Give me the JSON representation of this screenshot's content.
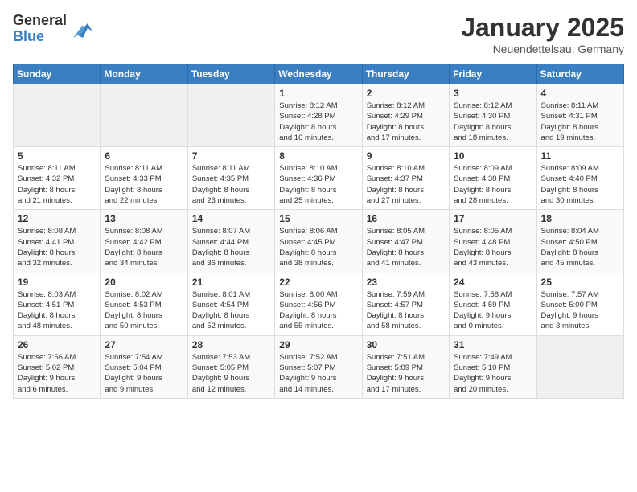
{
  "header": {
    "logo_general": "General",
    "logo_blue": "Blue",
    "month_title": "January 2025",
    "location": "Neuendettelsau, Germany"
  },
  "calendar": {
    "days_of_week": [
      "Sunday",
      "Monday",
      "Tuesday",
      "Wednesday",
      "Thursday",
      "Friday",
      "Saturday"
    ],
    "weeks": [
      [
        {
          "day": "",
          "info": ""
        },
        {
          "day": "",
          "info": ""
        },
        {
          "day": "",
          "info": ""
        },
        {
          "day": "1",
          "info": "Sunrise: 8:12 AM\nSunset: 4:28 PM\nDaylight: 8 hours\nand 16 minutes."
        },
        {
          "day": "2",
          "info": "Sunrise: 8:12 AM\nSunset: 4:29 PM\nDaylight: 8 hours\nand 17 minutes."
        },
        {
          "day": "3",
          "info": "Sunrise: 8:12 AM\nSunset: 4:30 PM\nDaylight: 8 hours\nand 18 minutes."
        },
        {
          "day": "4",
          "info": "Sunrise: 8:11 AM\nSunset: 4:31 PM\nDaylight: 8 hours\nand 19 minutes."
        }
      ],
      [
        {
          "day": "5",
          "info": "Sunrise: 8:11 AM\nSunset: 4:32 PM\nDaylight: 8 hours\nand 21 minutes."
        },
        {
          "day": "6",
          "info": "Sunrise: 8:11 AM\nSunset: 4:33 PM\nDaylight: 8 hours\nand 22 minutes."
        },
        {
          "day": "7",
          "info": "Sunrise: 8:11 AM\nSunset: 4:35 PM\nDaylight: 8 hours\nand 23 minutes."
        },
        {
          "day": "8",
          "info": "Sunrise: 8:10 AM\nSunset: 4:36 PM\nDaylight: 8 hours\nand 25 minutes."
        },
        {
          "day": "9",
          "info": "Sunrise: 8:10 AM\nSunset: 4:37 PM\nDaylight: 8 hours\nand 27 minutes."
        },
        {
          "day": "10",
          "info": "Sunrise: 8:09 AM\nSunset: 4:38 PM\nDaylight: 8 hours\nand 28 minutes."
        },
        {
          "day": "11",
          "info": "Sunrise: 8:09 AM\nSunset: 4:40 PM\nDaylight: 8 hours\nand 30 minutes."
        }
      ],
      [
        {
          "day": "12",
          "info": "Sunrise: 8:08 AM\nSunset: 4:41 PM\nDaylight: 8 hours\nand 32 minutes."
        },
        {
          "day": "13",
          "info": "Sunrise: 8:08 AM\nSunset: 4:42 PM\nDaylight: 8 hours\nand 34 minutes."
        },
        {
          "day": "14",
          "info": "Sunrise: 8:07 AM\nSunset: 4:44 PM\nDaylight: 8 hours\nand 36 minutes."
        },
        {
          "day": "15",
          "info": "Sunrise: 8:06 AM\nSunset: 4:45 PM\nDaylight: 8 hours\nand 38 minutes."
        },
        {
          "day": "16",
          "info": "Sunrise: 8:05 AM\nSunset: 4:47 PM\nDaylight: 8 hours\nand 41 minutes."
        },
        {
          "day": "17",
          "info": "Sunrise: 8:05 AM\nSunset: 4:48 PM\nDaylight: 8 hours\nand 43 minutes."
        },
        {
          "day": "18",
          "info": "Sunrise: 8:04 AM\nSunset: 4:50 PM\nDaylight: 8 hours\nand 45 minutes."
        }
      ],
      [
        {
          "day": "19",
          "info": "Sunrise: 8:03 AM\nSunset: 4:51 PM\nDaylight: 8 hours\nand 48 minutes."
        },
        {
          "day": "20",
          "info": "Sunrise: 8:02 AM\nSunset: 4:53 PM\nDaylight: 8 hours\nand 50 minutes."
        },
        {
          "day": "21",
          "info": "Sunrise: 8:01 AM\nSunset: 4:54 PM\nDaylight: 8 hours\nand 52 minutes."
        },
        {
          "day": "22",
          "info": "Sunrise: 8:00 AM\nSunset: 4:56 PM\nDaylight: 8 hours\nand 55 minutes."
        },
        {
          "day": "23",
          "info": "Sunrise: 7:59 AM\nSunset: 4:57 PM\nDaylight: 8 hours\nand 58 minutes."
        },
        {
          "day": "24",
          "info": "Sunrise: 7:58 AM\nSunset: 4:59 PM\nDaylight: 9 hours\nand 0 minutes."
        },
        {
          "day": "25",
          "info": "Sunrise: 7:57 AM\nSunset: 5:00 PM\nDaylight: 9 hours\nand 3 minutes."
        }
      ],
      [
        {
          "day": "26",
          "info": "Sunrise: 7:56 AM\nSunset: 5:02 PM\nDaylight: 9 hours\nand 6 minutes."
        },
        {
          "day": "27",
          "info": "Sunrise: 7:54 AM\nSunset: 5:04 PM\nDaylight: 9 hours\nand 9 minutes."
        },
        {
          "day": "28",
          "info": "Sunrise: 7:53 AM\nSunset: 5:05 PM\nDaylight: 9 hours\nand 12 minutes."
        },
        {
          "day": "29",
          "info": "Sunrise: 7:52 AM\nSunset: 5:07 PM\nDaylight: 9 hours\nand 14 minutes."
        },
        {
          "day": "30",
          "info": "Sunrise: 7:51 AM\nSunset: 5:09 PM\nDaylight: 9 hours\nand 17 minutes."
        },
        {
          "day": "31",
          "info": "Sunrise: 7:49 AM\nSunset: 5:10 PM\nDaylight: 9 hours\nand 20 minutes."
        },
        {
          "day": "",
          "info": ""
        }
      ]
    ]
  }
}
